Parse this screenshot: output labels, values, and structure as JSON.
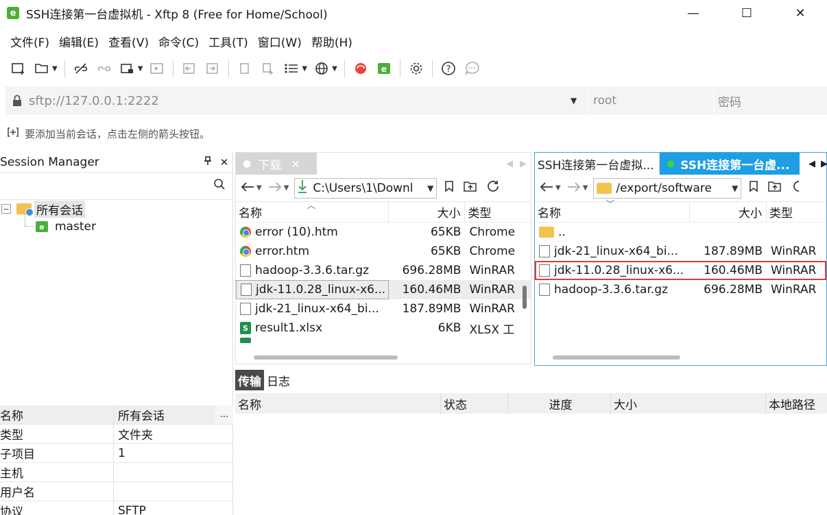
{
  "window": {
    "title": "SSH连接第一台虚拟机 - Xftp 8 (Free for Home/School)",
    "app_icon": "xftp-icon",
    "minimize_glyph": "—",
    "maximize_glyph": "☐",
    "close_glyph": "✕"
  },
  "menu": [
    "文件(F)",
    "编辑(E)",
    "查看(V)",
    "命令(C)",
    "工具(T)",
    "窗口(W)",
    "帮助(H)"
  ],
  "address": {
    "url": "sftp://127.0.0.1:2222",
    "user_placeholder": "root",
    "password_placeholder": "密码"
  },
  "hint": "要添加当前会话，点击左侧的箭头按钮。",
  "session_manager": {
    "title": "Session Manager",
    "tree_root": "所有会话",
    "tree_child": "master",
    "properties_header": {
      "key": "名称",
      "value": "所有会话",
      "more": "..."
    },
    "properties": [
      {
        "key": "类型",
        "value": "文件夹"
      },
      {
        "key": "子项目",
        "value": "1"
      },
      {
        "key": "主机",
        "value": ""
      },
      {
        "key": "用户名",
        "value": ""
      },
      {
        "key": "协议",
        "value": "SFTP"
      }
    ]
  },
  "local": {
    "tab_label": "下载",
    "path": "C:\\Users\\1\\Downl",
    "columns": {
      "name": "名称",
      "size": "大小",
      "type": "类型"
    },
    "files": [
      {
        "name": "error (10).htm",
        "size": "65KB",
        "type": "Chrome",
        "icon": "chrome"
      },
      {
        "name": "error.htm",
        "size": "65KB",
        "type": "Chrome",
        "icon": "chrome"
      },
      {
        "name": "hadoop-3.3.6.tar.gz",
        "size": "696.28MB",
        "type": "WinRAR",
        "icon": "doc"
      },
      {
        "name": "jdk-11.0.28_linux-x6...",
        "size": "160.46MB",
        "type": "WinRAR",
        "icon": "doc",
        "selected": true
      },
      {
        "name": "jdk-21_linux-x64_bi...",
        "size": "187.89MB",
        "type": "WinRAR",
        "icon": "doc"
      },
      {
        "name": "result1.xlsx",
        "size": "6KB",
        "type": "XLSX 工",
        "icon": "xlsx"
      }
    ]
  },
  "remote": {
    "tab_inactive": "SSH连接第一台虚拟...",
    "tab_active": "SSH连接第一台虚...",
    "path": "/export/software",
    "columns": {
      "name": "名称",
      "size": "大小",
      "type": "类型"
    },
    "parent": "..",
    "files": [
      {
        "name": "jdk-21_linux-x64_bi...",
        "size": "187.89MB",
        "type": "WinRAR"
      },
      {
        "name": "jdk-11.0.28_linux-x6...",
        "size": "160.46MB",
        "type": "WinRAR",
        "highlight": true
      },
      {
        "name": "hadoop-3.3.6.tar.gz",
        "size": "696.28MB",
        "type": "WinRAR"
      }
    ]
  },
  "transfer": {
    "tab_transfer": "传输",
    "tab_log": "日志",
    "columns": [
      "名称",
      "状态",
      "进度",
      "大小",
      "本地路径"
    ]
  },
  "colors": {
    "accent": "#1e9ee3",
    "highlight_box": "#e8383a",
    "session_green": "#4caf3a"
  }
}
